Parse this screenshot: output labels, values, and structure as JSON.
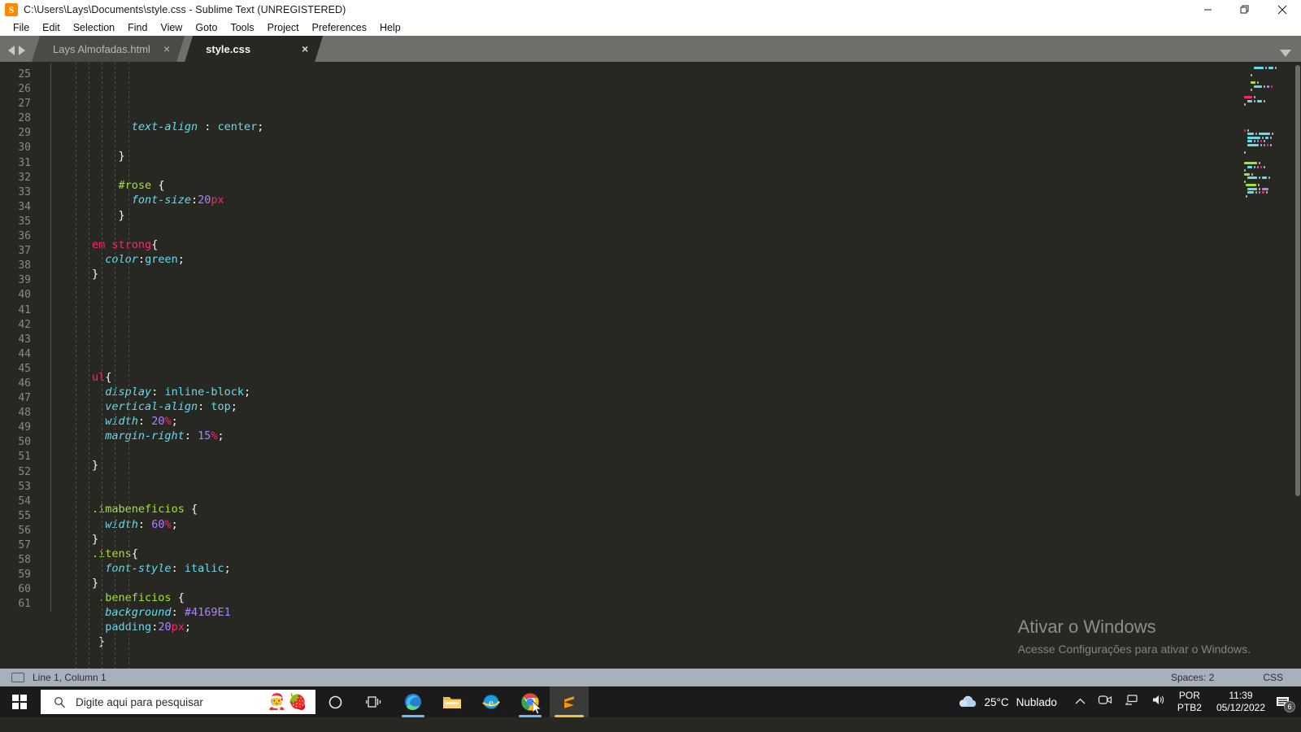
{
  "window": {
    "title": "C:\\Users\\Lays\\Documents\\style.css - Sublime Text (UNREGISTERED)",
    "app_icon": "sublime-text-icon",
    "minimize_label": "Minimize",
    "maximize_label": "Restore",
    "close_label": "Close"
  },
  "menubar": {
    "items": [
      {
        "label": "File"
      },
      {
        "label": "Edit"
      },
      {
        "label": "Selection"
      },
      {
        "label": "Find"
      },
      {
        "label": "View"
      },
      {
        "label": "Goto"
      },
      {
        "label": "Tools"
      },
      {
        "label": "Project"
      },
      {
        "label": "Preferences"
      },
      {
        "label": "Help"
      }
    ]
  },
  "tabbar": {
    "nav_prev": "prev-tab-arrow",
    "nav_next": "next-tab-arrow",
    "tabs": [
      {
        "label": "Lays Almofadas.html",
        "active": false,
        "close": "×"
      },
      {
        "label": "style.css",
        "active": true,
        "close": "×"
      }
    ],
    "dropdown": "tab-list-dropdown"
  },
  "editor": {
    "first_line": 25,
    "last_line": 61,
    "lines": [
      {
        "n": 25,
        "indent": 4,
        "tokens": [
          {
            "t": "prop",
            "v": "text-align"
          },
          {
            "t": "punct",
            "v": " : "
          },
          {
            "t": "val",
            "v": "center"
          },
          {
            "t": "punct",
            "v": ";"
          }
        ]
      },
      {
        "n": 26,
        "indent": 0,
        "tokens": []
      },
      {
        "n": 27,
        "indent": 3,
        "tokens": [
          {
            "t": "punct",
            "v": "}"
          }
        ]
      },
      {
        "n": 28,
        "indent": 0,
        "tokens": []
      },
      {
        "n": 29,
        "indent": 3,
        "tokens": [
          {
            "t": "sel",
            "v": "#rose"
          },
          {
            "t": "punct",
            "v": " {"
          }
        ]
      },
      {
        "n": 30,
        "indent": 4,
        "tokens": [
          {
            "t": "prop",
            "v": "font-size"
          },
          {
            "t": "punct",
            "v": ":"
          },
          {
            "t": "num",
            "v": "20"
          },
          {
            "t": "unit",
            "v": "px"
          }
        ]
      },
      {
        "n": 31,
        "indent": 3,
        "tokens": [
          {
            "t": "punct",
            "v": "}"
          }
        ]
      },
      {
        "n": 32,
        "indent": 0,
        "tokens": []
      },
      {
        "n": 33,
        "indent": 1,
        "tokens": [
          {
            "t": "tag",
            "v": "em strong"
          },
          {
            "t": "punct",
            "v": "{"
          }
        ]
      },
      {
        "n": 34,
        "indent": 2,
        "tokens": [
          {
            "t": "prop",
            "v": "color"
          },
          {
            "t": "punct",
            "v": ":"
          },
          {
            "t": "val",
            "v": "green"
          },
          {
            "t": "punct",
            "v": ";"
          }
        ]
      },
      {
        "n": 35,
        "indent": 1,
        "tokens": [
          {
            "t": "punct",
            "v": "}"
          }
        ]
      },
      {
        "n": 36,
        "indent": 0,
        "tokens": []
      },
      {
        "n": 37,
        "indent": 0,
        "tokens": []
      },
      {
        "n": 38,
        "indent": 0,
        "tokens": []
      },
      {
        "n": 39,
        "indent": 0,
        "tokens": []
      },
      {
        "n": 40,
        "indent": 0,
        "tokens": []
      },
      {
        "n": 41,
        "indent": 0,
        "tokens": []
      },
      {
        "n": 42,
        "indent": 1,
        "tokens": [
          {
            "t": "tag",
            "v": "ul"
          },
          {
            "t": "punct",
            "v": "{"
          }
        ]
      },
      {
        "n": 43,
        "indent": 2,
        "tokens": [
          {
            "t": "prop",
            "v": "display"
          },
          {
            "t": "punct",
            "v": ": "
          },
          {
            "t": "val",
            "v": "inline-block"
          },
          {
            "t": "punct",
            "v": ";"
          }
        ]
      },
      {
        "n": 44,
        "indent": 2,
        "tokens": [
          {
            "t": "prop",
            "v": "vertical-align"
          },
          {
            "t": "punct",
            "v": ": "
          },
          {
            "t": "val",
            "v": "top"
          },
          {
            "t": "punct",
            "v": ";"
          }
        ]
      },
      {
        "n": 45,
        "indent": 2,
        "tokens": [
          {
            "t": "prop",
            "v": "width"
          },
          {
            "t": "punct",
            "v": ": "
          },
          {
            "t": "num",
            "v": "20"
          },
          {
            "t": "unit",
            "v": "%"
          },
          {
            "t": "punct",
            "v": ";"
          }
        ]
      },
      {
        "n": 46,
        "indent": 2,
        "tokens": [
          {
            "t": "prop",
            "v": "margin-right"
          },
          {
            "t": "punct",
            "v": ": "
          },
          {
            "t": "num",
            "v": "15"
          },
          {
            "t": "unit",
            "v": "%"
          },
          {
            "t": "punct",
            "v": ";"
          }
        ]
      },
      {
        "n": 47,
        "indent": 0,
        "tokens": []
      },
      {
        "n": 48,
        "indent": 1,
        "tokens": [
          {
            "t": "punct",
            "v": "}"
          }
        ]
      },
      {
        "n": 49,
        "indent": 0,
        "tokens": []
      },
      {
        "n": 50,
        "indent": 0,
        "tokens": []
      },
      {
        "n": 51,
        "indent": 1,
        "tokens": [
          {
            "t": "sel",
            "v": ".imabeneficios"
          },
          {
            "t": "punct",
            "v": " {"
          }
        ]
      },
      {
        "n": 52,
        "indent": 2,
        "tokens": [
          {
            "t": "prop",
            "v": "width"
          },
          {
            "t": "punct",
            "v": ": "
          },
          {
            "t": "num",
            "v": "60"
          },
          {
            "t": "unit",
            "v": "%"
          },
          {
            "t": "punct",
            "v": ";"
          }
        ]
      },
      {
        "n": 53,
        "indent": 1,
        "tokens": [
          {
            "t": "punct",
            "v": "}"
          }
        ]
      },
      {
        "n": 54,
        "indent": 1,
        "tokens": [
          {
            "t": "sel",
            "v": ".itens"
          },
          {
            "t": "punct",
            "v": "{"
          }
        ]
      },
      {
        "n": 55,
        "indent": 2,
        "tokens": [
          {
            "t": "prop",
            "v": "font-style"
          },
          {
            "t": "punct",
            "v": ": "
          },
          {
            "t": "val",
            "v": "italic"
          },
          {
            "t": "punct",
            "v": ";"
          }
        ]
      },
      {
        "n": 56,
        "indent": 1,
        "tokens": [
          {
            "t": "punct",
            "v": "}"
          }
        ]
      },
      {
        "n": 57,
        "indent": 1.5,
        "tokens": [
          {
            "t": "sel",
            "v": ".beneficios"
          },
          {
            "t": "punct",
            "v": " {"
          }
        ]
      },
      {
        "n": 58,
        "indent": 2,
        "tokens": [
          {
            "t": "prop",
            "v": "background"
          },
          {
            "t": "punct",
            "v": ": "
          },
          {
            "t": "hex",
            "v": "#4169E1"
          }
        ]
      },
      {
        "n": 59,
        "indent": 2,
        "tokens": [
          {
            "t": "prop-n",
            "v": "padding"
          },
          {
            "t": "punct",
            "v": ":"
          },
          {
            "t": "num",
            "v": "20"
          },
          {
            "t": "unit",
            "v": "px"
          },
          {
            "t": "punct",
            "v": ";"
          }
        ]
      },
      {
        "n": 60,
        "indent": 1.5,
        "tokens": [
          {
            "t": "punct",
            "v": "}"
          }
        ]
      },
      {
        "n": 61,
        "indent": 0,
        "tokens": []
      }
    ],
    "colors": {
      "background": "#272822",
      "selector": "#a6e22e",
      "tag": "#f92672",
      "property": "#66d9ef",
      "number": "#ae81ff",
      "unit": "#f92672",
      "text": "#f8f8f2",
      "gutter": "#8a8a82"
    },
    "minimap": "code-minimap",
    "scrollbar": "vertical-scrollbar"
  },
  "watermark": {
    "title": "Ativar o Windows",
    "subtitle": "Acesse Configurações para ativar o Windows."
  },
  "statusbar": {
    "position": "Line 1, Column 1",
    "spaces": "Spaces: 2",
    "syntax": "CSS"
  },
  "taskbar": {
    "start": "windows-start-button",
    "search": {
      "placeholder": "Digite aqui para pesquisar",
      "icon": "search-icon",
      "emoji": [
        "🧑‍🎄",
        "🍓"
      ]
    },
    "buttons": [
      {
        "name": "cortana-button",
        "label": "Cortana"
      },
      {
        "name": "task-view-button",
        "label": "Task View"
      },
      {
        "name": "microsoft-edge-button",
        "label": "Microsoft Edge"
      },
      {
        "name": "file-explorer-button",
        "label": "File Explorer"
      },
      {
        "name": "internet-explorer-button",
        "label": "Internet Explorer"
      },
      {
        "name": "google-chrome-button",
        "label": "Google Chrome"
      },
      {
        "name": "sublime-text-button",
        "label": "Sublime Text"
      }
    ],
    "tray": {
      "weather_temp": "25°C",
      "weather_desc": "Nublado",
      "show_hidden": "show-hidden-icons-chevron",
      "meet_now": "meet-now-icon",
      "network": "network-icon",
      "volume": "volume-icon",
      "lang_line1": "POR",
      "lang_line2": "PTB2",
      "time": "11:39",
      "date": "05/12/2022",
      "notifications_count": "6"
    }
  }
}
